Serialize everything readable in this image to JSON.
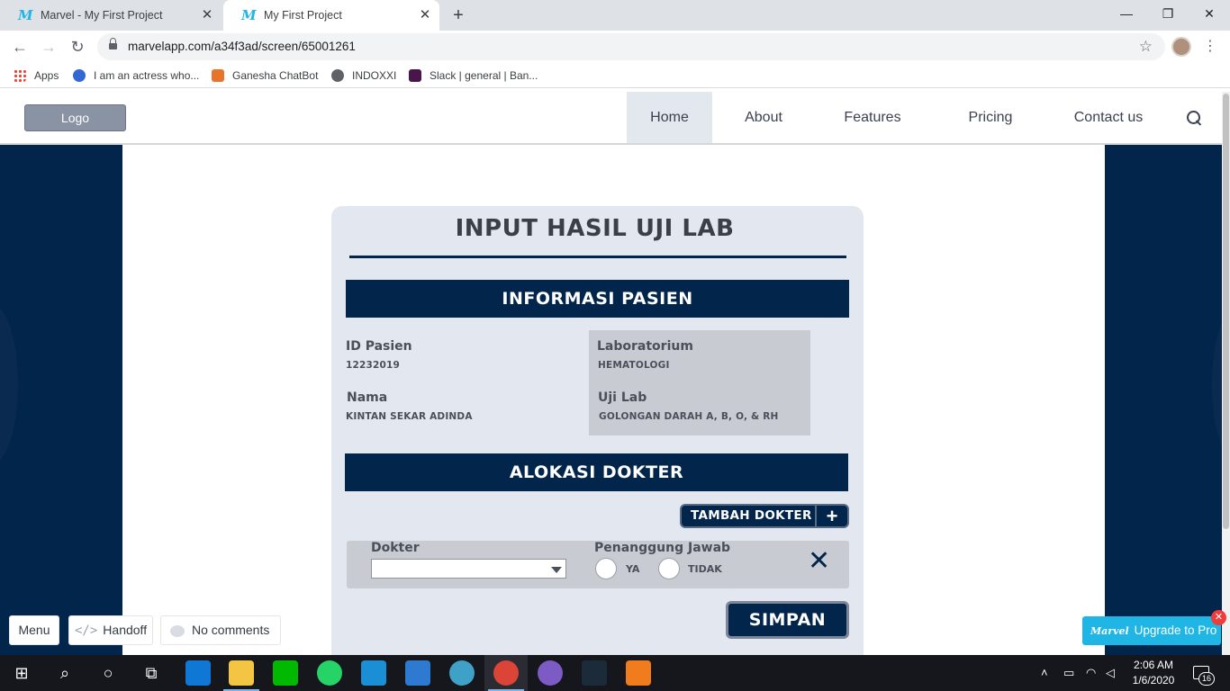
{
  "browser": {
    "tabs": [
      {
        "title": "Marvel - My First Project",
        "icon": "marvel-icon"
      },
      {
        "title": "My First Project",
        "icon": "marvel-icon"
      }
    ],
    "url": "marvelapp.com/a34f3ad/screen/65001261",
    "bookmarks": [
      {
        "label": "Apps",
        "icon": "apps-grid-icon"
      },
      {
        "label": "I am an actress who...",
        "icon": "c-icon"
      },
      {
        "label": "Ganesha ChatBot",
        "icon": "bot-icon"
      },
      {
        "label": "INDOXXI",
        "icon": "globe-icon"
      },
      {
        "label": "Slack | general | Ban...",
        "icon": "slack-icon"
      }
    ]
  },
  "site_nav": {
    "logo": "Logo",
    "links": [
      "Home",
      "About",
      "Features",
      "Pricing",
      "Contact us"
    ],
    "active": "Home"
  },
  "form": {
    "title": "INPUT HASIL UJI LAB",
    "patient_section": "INFORMASI PASIEN",
    "id_label": "ID Pasien",
    "id_value": "12232019",
    "name_label": "Nama",
    "name_value": "KINTAN SEKAR ADINDA",
    "lab_label": "Laboratorium",
    "lab_value": "HEMATOLOGI",
    "test_label": "Uji Lab",
    "test_value": "GOLONGAN DARAH A, B, O, & RH",
    "doctor_section": "ALOKASI DOKTER",
    "add_doctor": "TAMBAH DOKTER",
    "doctor_label": "Dokter",
    "doctor_value": "",
    "responsible_label": "Penanggung Jawab",
    "yes_label": "YA",
    "no_label": "TIDAK",
    "save": "SIMPAN"
  },
  "marvel_overlay": {
    "menu": "Menu",
    "handoff": "Handoff",
    "comments": "No comments",
    "upgrade": "Upgrade to Pro",
    "brand": "Marvel"
  },
  "taskbar": {
    "time": "2:06 AM",
    "date": "1/6/2020",
    "notifications": "16"
  },
  "colors": {
    "navy": "#02254c",
    "card": "#e3e7ef",
    "marvel_blue": "#1fb6e6"
  }
}
